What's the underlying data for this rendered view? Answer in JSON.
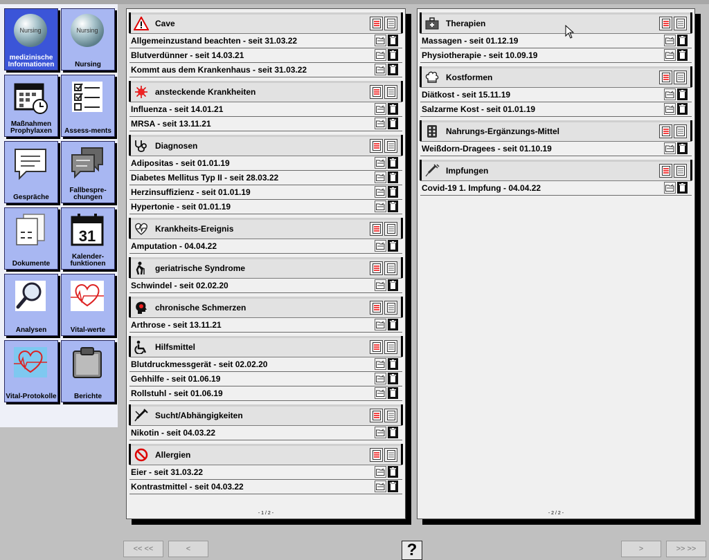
{
  "nav": [
    {
      "label": "medizinische Informationen",
      "icon": "globe-icon",
      "ball_text": "Nursing"
    },
    {
      "label": "Nursing",
      "icon": "globe-icon",
      "ball_text": "Nursing"
    },
    {
      "label": "Maßnahmen Prophylaxen",
      "icon": "calendar-clock-icon"
    },
    {
      "label": "Assess-ments",
      "icon": "checklist-icon"
    },
    {
      "label": "Gespräche",
      "icon": "speech-bubble-icon"
    },
    {
      "label": "Fallbespre-chungen",
      "icon": "chat-bubbles-icon"
    },
    {
      "label": "Dokumente",
      "icon": "documents-icon"
    },
    {
      "label": "Kalender-funktionen",
      "icon": "calendar-icon",
      "day": "31"
    },
    {
      "label": "Analysen",
      "icon": "magnifier-icon"
    },
    {
      "label": "Vital-werte",
      "icon": "heart-pulse-icon"
    },
    {
      "label": "Vital-Protokolle",
      "icon": "heart-pulse-icon"
    },
    {
      "label": "Berichte",
      "icon": "clipboard-icon"
    }
  ],
  "pages": [
    {
      "footer": "- 1 / 2 -",
      "sections": [
        {
          "title": "Cave",
          "icon": "warning-triangle-icon",
          "items": [
            "Allgemeinzustand beachten - seit 31.03.22",
            "Blutverdünner - seit 14.03.21",
            "Kommt aus dem Krankenhaus - seit 31.03.22"
          ]
        },
        {
          "title": "ansteckende Krankheiten",
          "icon": "virus-icon",
          "items": [
            "Influenza - seit 14.01.21",
            "MRSA - seit 13.11.21"
          ]
        },
        {
          "title": "Diagnosen",
          "icon": "stethoscope-icon",
          "items": [
            "Adipositas - seit 01.01.19",
            "Diabetes Mellitus Typ II - seit 28.03.22",
            "Herzinsuffizienz - seit 01.01.19",
            "Hypertonie - seit 01.01.19"
          ]
        },
        {
          "title": "Krankheits-Ereignis",
          "icon": "heartbeat-icon",
          "items": [
            "Amputation - 04.04.22"
          ]
        },
        {
          "title": "geriatrische Syndrome",
          "icon": "elderly-person-icon",
          "items": [
            "Schwindel - seit 02.02.20"
          ]
        },
        {
          "title": "chronische Schmerzen",
          "icon": "head-pain-icon",
          "items": [
            "Arthrose - seit 13.11.21"
          ]
        },
        {
          "title": "Hilfsmittel",
          "icon": "wheelchair-icon",
          "items": [
            "Blutdruckmessgerät - seit 02.02.20",
            "Gehhilfe - seit 01.06.19",
            "Rollstuhl - seit 01.06.19"
          ]
        },
        {
          "title": "Sucht/Abhängigkeiten",
          "icon": "syringe-addiction-icon",
          "items": [
            "Nikotin - seit 04.03.22"
          ]
        },
        {
          "title": "Allergien",
          "icon": "prohibition-icon",
          "items": [
            "Eier - seit 31.03.22",
            "Kontrastmittel - seit 04.03.22"
          ]
        }
      ]
    },
    {
      "footer": "- 2 / 2 -",
      "sections": [
        {
          "title": "Therapien",
          "icon": "medical-bag-icon",
          "items": [
            "Massagen - seit 01.12.19",
            "Physiotherapie - seit 10.09.19"
          ]
        },
        {
          "title": "Kostformen",
          "icon": "chef-hat-icon",
          "items": [
            "Diätkost - seit 15.11.19",
            "Salzarme Kost - seit 01.01.19"
          ]
        },
        {
          "title": "Nahrungs-Ergänzungs-Mittel",
          "icon": "pill-box-icon",
          "items": [
            "Weißdorn-Dragees - seit 01.10.19"
          ]
        },
        {
          "title": "Impfungen",
          "icon": "vaccine-syringe-icon",
          "items": [
            "Covid-19 1. Impfung - 04.04.22"
          ]
        }
      ]
    }
  ],
  "bottom": {
    "first": "<< <<",
    "prev": "<",
    "help": "?",
    "next": ">",
    "last": ">> >>"
  }
}
